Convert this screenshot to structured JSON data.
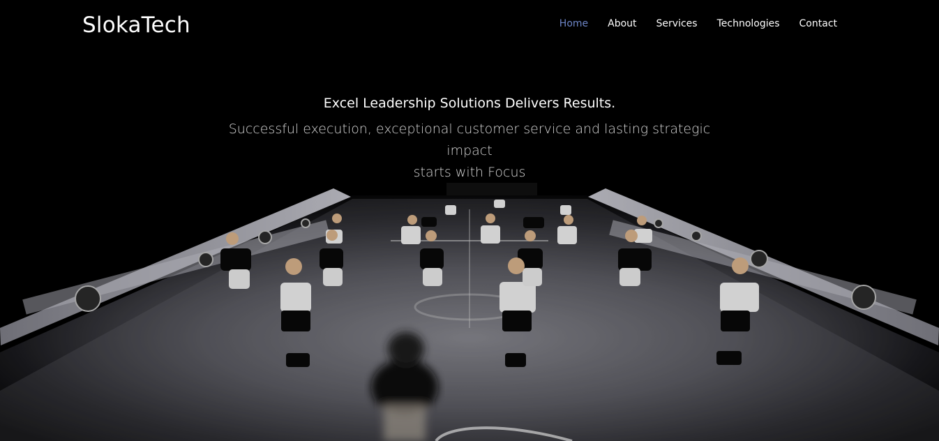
{
  "brand": {
    "name": "SlokaTech"
  },
  "nav": {
    "items": [
      {
        "label": "Home",
        "active": true
      },
      {
        "label": "About",
        "active": false
      },
      {
        "label": "Services",
        "active": false
      },
      {
        "label": "Technologies",
        "active": false
      },
      {
        "label": "Contact",
        "active": false
      }
    ]
  },
  "hero": {
    "headline": "Excel Leadership Solutions Delivers Results.",
    "subheadline_line1": "Successful execution, exceptional customer service and lasting strategic impact",
    "subheadline_line2": "starts with Focus"
  },
  "colors": {
    "background": "#000000",
    "nav_active": "#6e86c8",
    "text_primary": "#ffffff",
    "text_secondary": "#d7d7d7"
  }
}
